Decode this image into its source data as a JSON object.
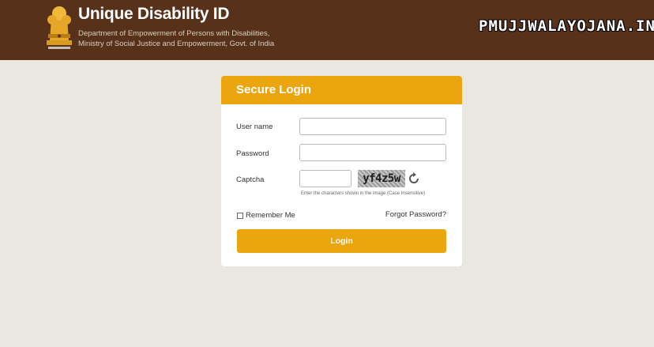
{
  "header": {
    "title": "Unique Disability ID",
    "subtitle_line1": "Department of Empowerment of Persons with Disabilities,",
    "subtitle_line2": "Ministry of Social Justice and Empowerment, Govt. of India",
    "emblem_icon": "national-emblem-icon",
    "watermark": "PMUJJWALAYOJANA.IN",
    "bg_color": "#573119"
  },
  "login": {
    "heading": "Secure Login",
    "username_label": "User name",
    "username_value": "",
    "password_label": "Password",
    "password_value": "",
    "captcha_label": "Captcha",
    "captcha_value": "",
    "captcha_text": "yf4z5w",
    "captcha_hint": "Enter the characters shown in the image (Case Insensitive)",
    "refresh_icon": "refresh-icon",
    "remember_label": "Remember Me",
    "remember_checked": false,
    "forgot_label": "Forgot Password?",
    "login_button": "Login",
    "accent_color": "#eba50f"
  }
}
